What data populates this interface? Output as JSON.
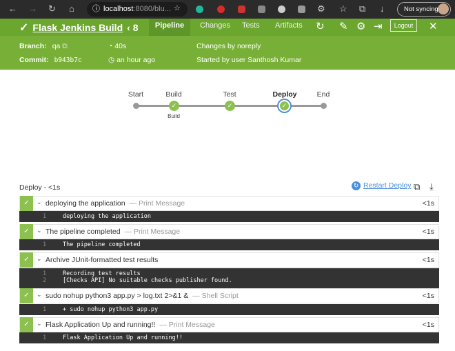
{
  "browser": {
    "url_host": "localhost",
    "url_rest": ":8080/blu...",
    "sync_label": "Not syncing"
  },
  "header": {
    "title": "Flask Jenkins Build",
    "run": "8",
    "tabs": [
      "Pipeline",
      "Changes",
      "Tests",
      "Artifacts"
    ],
    "logout": "Logout",
    "branch_label": "Branch:",
    "branch": "qa",
    "commit_label": "Commit:",
    "commit": "b943b7c",
    "duration": "40s",
    "ago": "an hour ago",
    "changes": "Changes by noreply",
    "started": "Started by user Santhosh Kumar"
  },
  "pipeline": {
    "stages": [
      {
        "name": "Start"
      },
      {
        "name": "Build",
        "sub": "Build"
      },
      {
        "name": "Test"
      },
      {
        "name": "Deploy"
      },
      {
        "name": "End"
      }
    ]
  },
  "section": {
    "title": "Deploy - <1s",
    "restart": "Restart Deploy"
  },
  "steps": [
    {
      "name": "deploying the application",
      "type": "— Print Message",
      "time": "<1s",
      "log": [
        "deploying the application"
      ]
    },
    {
      "name": "The pipeline completed",
      "type": "— Print Message",
      "time": "<1s",
      "log": [
        "The pipeline completed"
      ]
    },
    {
      "name": "Archive JUnit-formatted test results",
      "type": "",
      "time": "<1s",
      "log": [
        "Recording test results",
        "[Checks API] No suitable checks publisher found."
      ]
    },
    {
      "name": "sudo nohup python3 app.py > log.txt 2>&1 &",
      "type": "— Shell Script",
      "time": "<1s",
      "log": [
        "+ sudo nohup python3 app.py"
      ]
    },
    {
      "name": "Flask Application Up and running!!",
      "type": "— Print Message",
      "time": "<1s",
      "log": [
        "Flask Application Up and running!!"
      ]
    }
  ],
  "colors": {
    "green": "#78b037",
    "dark_green": "#6ba62f",
    "success": "#8cc04f",
    "link": "#4a90d9"
  }
}
